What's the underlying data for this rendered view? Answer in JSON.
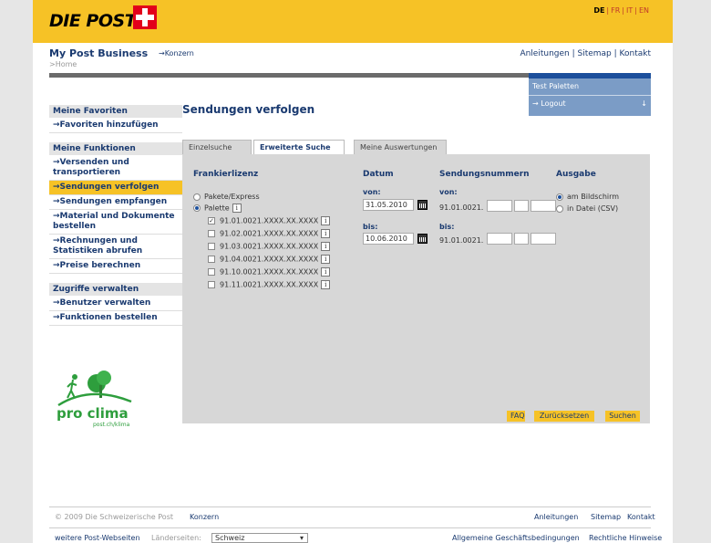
{
  "header": {
    "logo_text": "DIE POST",
    "languages": [
      "DE",
      "FR",
      "IT",
      "EN"
    ],
    "active_language": "DE",
    "brand_color": "#f6c226"
  },
  "top": {
    "brand": "My Post Business",
    "home": ">Home",
    "konzern": "→Konzern",
    "links": [
      "Anleitungen",
      "Sitemap",
      "Kontakt"
    ]
  },
  "userbox": {
    "name": "Test Paletten",
    "logout": "→ Logout",
    "logout_arrow": "↓"
  },
  "sidebar": {
    "favoriten_head": "Meine Favoriten",
    "favoriten_add": "→Favoriten hinzufügen",
    "funktionen_head": "Meine Funktionen",
    "funktionen": [
      "→Versenden und transportieren",
      "→Sendungen verfolgen",
      "→Sendungen empfangen",
      "→Material und Dokumente bestellen",
      "→Rechnungen und Statistiken abrufen",
      "→Preise berechnen"
    ],
    "zugriffe_head": "Zugriffe verwalten",
    "zugriffe": [
      "→Benutzer verwalten",
      "→Funktionen bestellen"
    ],
    "proclima_text": "pro clima",
    "proclima_url": "post.ch/klima"
  },
  "main": {
    "title": "Sendungen verfolgen",
    "tabs": [
      "Einzelsuche",
      "Erweiterte Suche",
      "Meine Auswertungen"
    ],
    "frankierlizenz_label": "Frankierlizenz",
    "radio_pakete": "Pakete/Express",
    "radio_palette": "Palette",
    "licences": [
      "91.01.0021.XXXX.XX.XXXX",
      "91.02.0021.XXXX.XX.XXXX",
      "91.03.0021.XXXX.XX.XXXX",
      "91.04.0021.XXXX.XX.XXXX",
      "91.10.0021.XXXX.XX.XXXX",
      "91.11.0021.XXXX.XX.XXXX"
    ],
    "info_glyph": "i",
    "check_glyph": "✓",
    "datum_label": "Datum",
    "von_label": "von:",
    "bis_label": "bis:",
    "date_from": "31.05.2010",
    "date_to": "10.06.2010",
    "sendungsnummern_label": "Sendungsnummern",
    "nr_prefix": "91.01.0021.",
    "ausgabe_label": "Ausgabe",
    "ausgabe_bildschirm": "am Bildschirm",
    "ausgabe_datei": "in Datei (CSV)",
    "faq": "FAQ",
    "reset": "Zurücksetzen",
    "search": "Suchen"
  },
  "footer": {
    "copyright": "© 2009 Die Schweizerische Post",
    "konzern": "Konzern",
    "links": [
      "Anleitungen",
      "Sitemap",
      "Kontakt"
    ],
    "weitere": "weitere Post-Webseiten",
    "laenderseiten": "Länderseiten:",
    "country": "Schweiz",
    "agb": "Allgemeine Geschäftsbedingungen",
    "rechtlich": "Rechtliche Hinweise"
  }
}
